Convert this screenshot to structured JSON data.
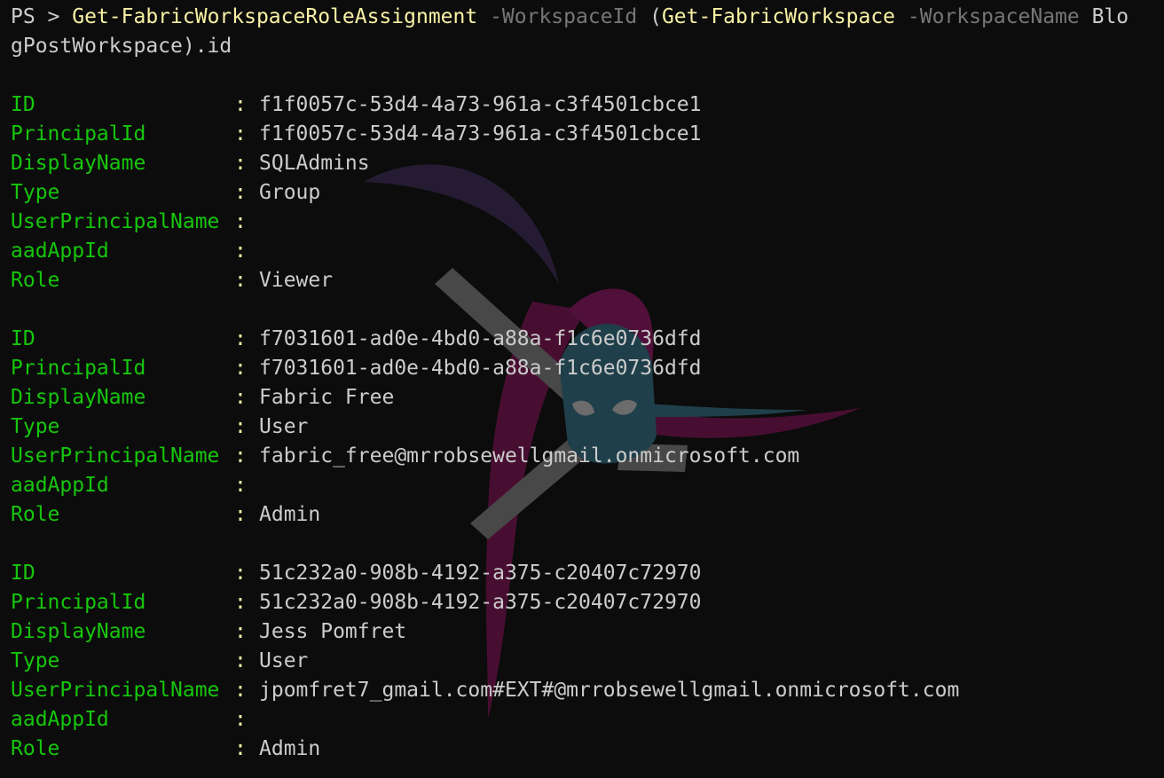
{
  "command": {
    "prompt": "PS > ",
    "cmdlet": "Get-FabricWorkspaceRoleAssignment",
    "param1": " -WorkspaceId",
    "open_paren": " (",
    "inner_cmdlet": "Get-FabricWorkspace",
    "param2": " -WorkspaceName",
    "arg_part1": " Blo",
    "arg_part2": "gPostWorkspace).id"
  },
  "separator": ":",
  "records": [
    {
      "fields": [
        {
          "key": "ID",
          "value": "f1f0057c-53d4-4a73-961a-c3f4501cbce1"
        },
        {
          "key": "PrincipalId",
          "value": "f1f0057c-53d4-4a73-961a-c3f4501cbce1"
        },
        {
          "key": "DisplayName",
          "value": "SQLAdmins"
        },
        {
          "key": "Type",
          "value": "Group"
        },
        {
          "key": "UserPrincipalName",
          "value": ""
        },
        {
          "key": "aadAppId",
          "value": ""
        },
        {
          "key": "Role",
          "value": "Viewer"
        }
      ]
    },
    {
      "fields": [
        {
          "key": "ID",
          "value": "f7031601-ad0e-4bd0-a88a-f1c6e0736dfd"
        },
        {
          "key": "PrincipalId",
          "value": "f7031601-ad0e-4bd0-a88a-f1c6e0736dfd"
        },
        {
          "key": "DisplayName",
          "value": "Fabric Free"
        },
        {
          "key": "Type",
          "value": "User"
        },
        {
          "key": "UserPrincipalName",
          "value": "fabric_free@mrrobsewellgmail.onmicrosoft.com"
        },
        {
          "key": "aadAppId",
          "value": ""
        },
        {
          "key": "Role",
          "value": "Admin"
        }
      ]
    },
    {
      "fields": [
        {
          "key": "ID",
          "value": "51c232a0-908b-4192-a375-c20407c72970"
        },
        {
          "key": "PrincipalId",
          "value": "51c232a0-908b-4192-a375-c20407c72970"
        },
        {
          "key": "DisplayName",
          "value": "Jess Pomfret"
        },
        {
          "key": "Type",
          "value": "User"
        },
        {
          "key": "UserPrincipalName",
          "value": "jpomfret7_gmail.com#EXT#@mrrobsewellgmail.onmicrosoft.com"
        },
        {
          "key": "aadAppId",
          "value": ""
        },
        {
          "key": "Role",
          "value": "Admin"
        }
      ]
    }
  ],
  "colors": {
    "background": "#0c0c0c",
    "cmdlet": "#f9f1a5",
    "parameter": "#767676",
    "property_name": "#16c60c",
    "text": "#cccccc"
  },
  "watermark_icon": "ninja-logo-icon"
}
